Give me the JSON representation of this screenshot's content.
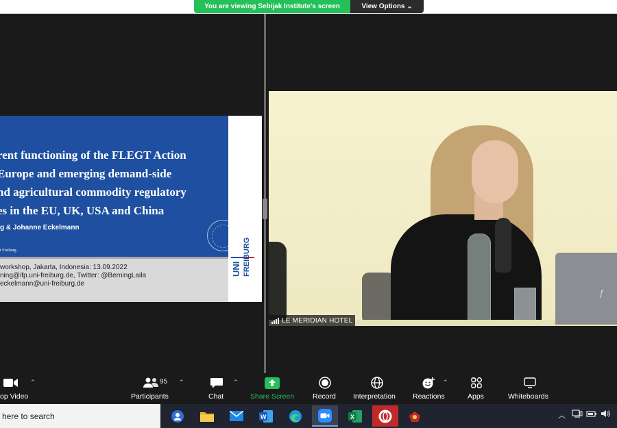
{
  "banner": {
    "sharing_text": "You are viewing Sebijak Institute's screen",
    "view_options_label": "View Options ⌄"
  },
  "slide": {
    "title": "rent functioning of the FLEGT Action\n Europe and emerging demand-side\nnd agricultural commodity regulatory\nes in the EU, UK, USA and China",
    "authors": "g & Johanne Eckelmann",
    "affiliation_small": "t Freiburg",
    "info": "workshop, Jakarta, Indonesia: 13.09.2022\nning@ifp.uni-freiburg.de, Twitter: @BerningLaila\neckelmann@uni-freiburg.de",
    "logo_line1": "UNI",
    "logo_line2": "FREIBURG",
    "colors": {
      "blue": "#1e4fa0",
      "logo_blue": "#1e4fa0",
      "logo_red": "#c1272d"
    }
  },
  "video": {
    "participant_name": "LE MERIDIAN HOTEL",
    "laptop_logo": "ƒ"
  },
  "toolbar": {
    "stop_video": "op Video",
    "participants": "Participants",
    "participants_count": "95",
    "chat": "Chat",
    "share_screen": "Share Screen",
    "record": "Record",
    "interpretation": "Interpretation",
    "reactions": "Reactions",
    "apps": "Apps",
    "whiteboards": "Whiteboards",
    "share_color": "#24c05a"
  },
  "taskbar": {
    "search_placeholder": "here to search",
    "apps": [
      "people-icon",
      "file-explorer-icon",
      "mail-icon",
      "word-icon",
      "edge-icon",
      "zoom-icon",
      "excel-icon",
      "opera-icon",
      "game-icon"
    ]
  }
}
